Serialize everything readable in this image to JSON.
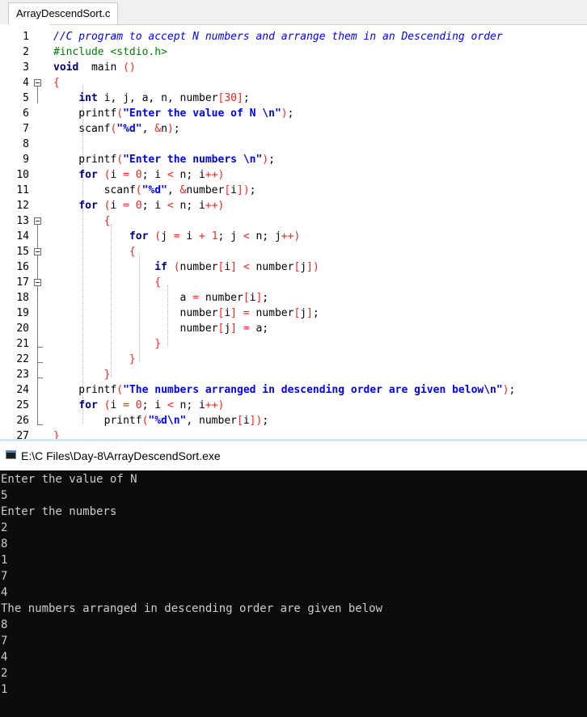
{
  "editor": {
    "tab_label": "ArrayDescendSort.c",
    "line_numbers": [
      "1",
      "2",
      "3",
      "4",
      "5",
      "6",
      "7",
      "8",
      "9",
      "10",
      "11",
      "12",
      "13",
      "14",
      "15",
      "16",
      "17",
      "18",
      "19",
      "20",
      "21",
      "22",
      "23",
      "24",
      "25",
      "26",
      "27"
    ],
    "code_lines": [
      [
        [
          "cm",
          "//C program to accept N numbers and arrange them in an Descending order"
        ]
      ],
      [
        [
          "pp",
          "#include <stdio.h>"
        ]
      ],
      [
        [
          "kw",
          "void"
        ],
        [
          "",
          "  main "
        ],
        [
          "op",
          "()"
        ]
      ],
      [
        [
          "op",
          "{"
        ]
      ],
      [
        [
          "",
          "    "
        ],
        [
          "kw",
          "int"
        ],
        [
          "",
          " i, j, a, n, number"
        ],
        [
          "op",
          "["
        ],
        [
          "nm",
          "30"
        ],
        [
          "op",
          "]"
        ],
        [
          "",
          ";"
        ]
      ],
      [
        [
          "",
          "    printf"
        ],
        [
          "op",
          "("
        ],
        [
          "st",
          "\"Enter the value of N \\n\""
        ],
        [
          "op",
          ")"
        ],
        [
          "",
          ";"
        ]
      ],
      [
        [
          "",
          "    scanf"
        ],
        [
          "op",
          "("
        ],
        [
          "st",
          "\"%d\""
        ],
        [
          "",
          ", "
        ],
        [
          "op",
          "&"
        ],
        [
          "",
          "n"
        ],
        [
          "op",
          ")"
        ],
        [
          "",
          ";"
        ]
      ],
      [
        [
          "",
          ""
        ]
      ],
      [
        [
          "",
          "    printf"
        ],
        [
          "op",
          "("
        ],
        [
          "st",
          "\"Enter the numbers \\n\""
        ],
        [
          "op",
          ")"
        ],
        [
          "",
          ";"
        ]
      ],
      [
        [
          "",
          "    "
        ],
        [
          "kw",
          "for"
        ],
        [
          "",
          " "
        ],
        [
          "op",
          "("
        ],
        [
          "",
          "i "
        ],
        [
          "op",
          "="
        ],
        [
          "",
          " "
        ],
        [
          "nm",
          "0"
        ],
        [
          "",
          "; i "
        ],
        [
          "op",
          "<"
        ],
        [
          "",
          " n; i"
        ],
        [
          "op",
          "++"
        ],
        [
          "op",
          ")"
        ]
      ],
      [
        [
          "",
          "        scanf"
        ],
        [
          "op",
          "("
        ],
        [
          "st",
          "\"%d\""
        ],
        [
          "",
          ", "
        ],
        [
          "op",
          "&"
        ],
        [
          "",
          "number"
        ],
        [
          "op",
          "["
        ],
        [
          "",
          "i"
        ],
        [
          "op",
          "]"
        ],
        [
          "op",
          ")"
        ],
        [
          "",
          ";"
        ]
      ],
      [
        [
          "",
          "    "
        ],
        [
          "kw",
          "for"
        ],
        [
          "",
          " "
        ],
        [
          "op",
          "("
        ],
        [
          "",
          "i "
        ],
        [
          "op",
          "="
        ],
        [
          "",
          " "
        ],
        [
          "nm",
          "0"
        ],
        [
          "",
          "; i "
        ],
        [
          "op",
          "<"
        ],
        [
          "",
          " n; i"
        ],
        [
          "op",
          "++"
        ],
        [
          "op",
          ")"
        ]
      ],
      [
        [
          "",
          "        "
        ],
        [
          "op",
          "{"
        ]
      ],
      [
        [
          "",
          "            "
        ],
        [
          "kw",
          "for"
        ],
        [
          "",
          " "
        ],
        [
          "op",
          "("
        ],
        [
          "",
          "j "
        ],
        [
          "op",
          "="
        ],
        [
          "",
          " i "
        ],
        [
          "op",
          "+"
        ],
        [
          "",
          " "
        ],
        [
          "nm",
          "1"
        ],
        [
          "",
          "; j "
        ],
        [
          "op",
          "<"
        ],
        [
          "",
          " n; j"
        ],
        [
          "op",
          "++"
        ],
        [
          "op",
          ")"
        ]
      ],
      [
        [
          "",
          "            "
        ],
        [
          "op",
          "{"
        ]
      ],
      [
        [
          "",
          "                "
        ],
        [
          "kw",
          "if"
        ],
        [
          "",
          " "
        ],
        [
          "op",
          "("
        ],
        [
          "",
          "number"
        ],
        [
          "op",
          "["
        ],
        [
          "",
          "i"
        ],
        [
          "op",
          "]"
        ],
        [
          "",
          " "
        ],
        [
          "op",
          "<"
        ],
        [
          "",
          " number"
        ],
        [
          "op",
          "["
        ],
        [
          "",
          "j"
        ],
        [
          "op",
          "]"
        ],
        [
          "op",
          ")"
        ]
      ],
      [
        [
          "",
          "                "
        ],
        [
          "op",
          "{"
        ]
      ],
      [
        [
          "",
          "                    a "
        ],
        [
          "op",
          "="
        ],
        [
          "",
          " number"
        ],
        [
          "op",
          "["
        ],
        [
          "",
          "i"
        ],
        [
          "op",
          "]"
        ],
        [
          "",
          ";"
        ]
      ],
      [
        [
          "",
          "                    number"
        ],
        [
          "op",
          "["
        ],
        [
          "",
          "i"
        ],
        [
          "op",
          "]"
        ],
        [
          "",
          " "
        ],
        [
          "op",
          "="
        ],
        [
          "",
          " number"
        ],
        [
          "op",
          "["
        ],
        [
          "",
          "j"
        ],
        [
          "op",
          "]"
        ],
        [
          "",
          ";"
        ]
      ],
      [
        [
          "",
          "                    number"
        ],
        [
          "op",
          "["
        ],
        [
          "",
          "j"
        ],
        [
          "op",
          "]"
        ],
        [
          "",
          " "
        ],
        [
          "op",
          "="
        ],
        [
          "",
          " a;"
        ]
      ],
      [
        [
          "",
          "                "
        ],
        [
          "op",
          "}"
        ]
      ],
      [
        [
          "",
          "            "
        ],
        [
          "op",
          "}"
        ]
      ],
      [
        [
          "",
          "        "
        ],
        [
          "op",
          "}"
        ]
      ],
      [
        [
          "",
          "    printf"
        ],
        [
          "op",
          "("
        ],
        [
          "st",
          "\"The numbers arranged in descending order are given below\\n\""
        ],
        [
          "op",
          ")"
        ],
        [
          "",
          ";"
        ]
      ],
      [
        [
          "",
          "    "
        ],
        [
          "kw",
          "for"
        ],
        [
          "",
          " "
        ],
        [
          "op",
          "("
        ],
        [
          "",
          "i "
        ],
        [
          "op",
          "="
        ],
        [
          "",
          " "
        ],
        [
          "nm",
          "0"
        ],
        [
          "",
          "; i "
        ],
        [
          "op",
          "<"
        ],
        [
          "",
          " n; i"
        ],
        [
          "op",
          "++"
        ],
        [
          "op",
          ")"
        ]
      ],
      [
        [
          "",
          "        printf"
        ],
        [
          "op",
          "("
        ],
        [
          "st",
          "\"%d\\n\""
        ],
        [
          "",
          ", number"
        ],
        [
          "op",
          "["
        ],
        [
          "",
          "i"
        ],
        [
          "op",
          "]"
        ],
        [
          "op",
          ")"
        ],
        [
          "",
          ";"
        ]
      ],
      [
        [
          "op",
          "}"
        ]
      ]
    ]
  },
  "console": {
    "title": "E:\\C Files\\Day-8\\ArrayDescendSort.exe",
    "icon": "console-window-icon",
    "lines": [
      "Enter the value of N",
      "5",
      "Enter the numbers",
      "2",
      "8",
      "1",
      "7",
      "4",
      "The numbers arranged in descending order are given below",
      "8",
      "7",
      "4",
      "2",
      "1"
    ]
  },
  "colors": {
    "comment": "#0000ff",
    "preprocessor": "#008000",
    "keyword": "#000080",
    "string": "#0000ff",
    "number": "#ff2020",
    "operator": "#ff2020",
    "console_bg": "#0c0c0c",
    "console_text": "#cccccc"
  }
}
